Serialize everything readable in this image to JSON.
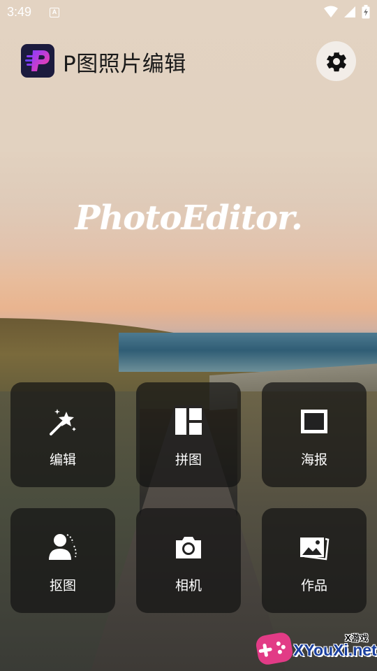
{
  "status_bar": {
    "time": "3:49",
    "notification_glyph": "A"
  },
  "header": {
    "app_title": "P图照片编辑",
    "logo_letter": "P"
  },
  "hero": {
    "text": "PhotoEditor."
  },
  "tiles": [
    {
      "label": "编辑",
      "icon": "magic-wand-icon"
    },
    {
      "label": "拼图",
      "icon": "collage-layout-icon"
    },
    {
      "label": "海报",
      "icon": "poster-frame-icon"
    },
    {
      "label": "抠图",
      "icon": "cutout-person-icon"
    },
    {
      "label": "相机",
      "icon": "camera-icon"
    },
    {
      "label": "作品",
      "icon": "gallery-icon"
    }
  ],
  "watermark": {
    "site": "XYouXi.net",
    "tag": "X游戏"
  },
  "colors": {
    "logo_bg": "#1c1b3e",
    "logo_gradient_start": "#8a3cff",
    "logo_gradient_end": "#ff3fa0",
    "badge_pink": "#e23b86",
    "badge_blue": "#1a3f9e"
  }
}
